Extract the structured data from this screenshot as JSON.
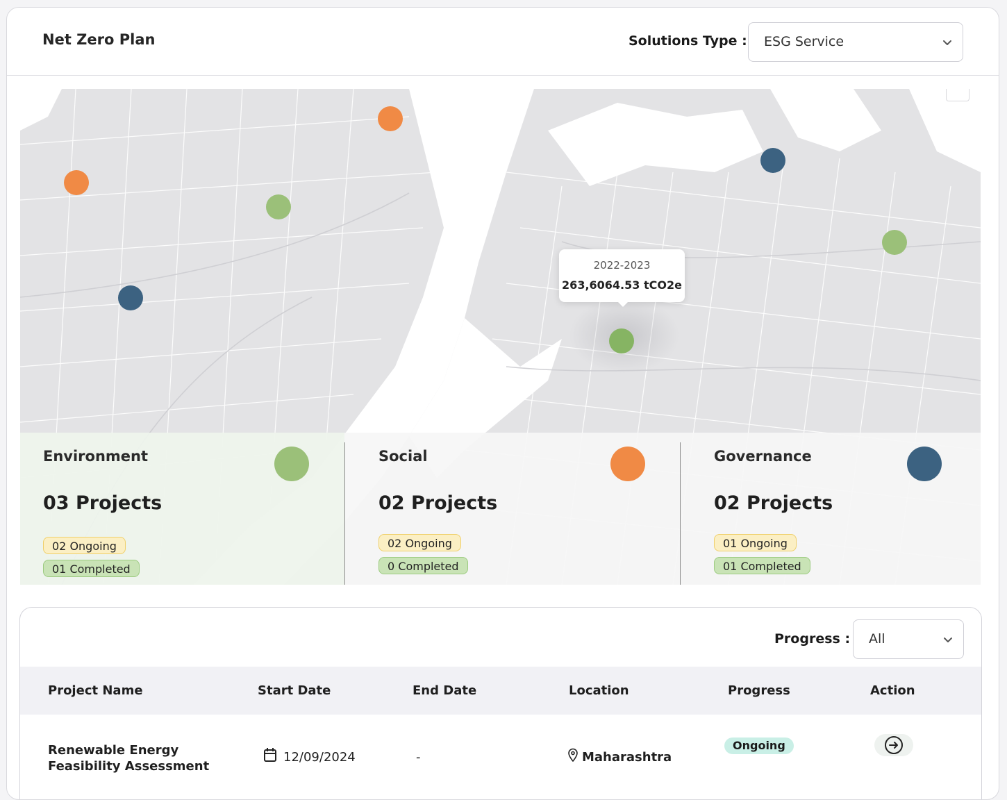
{
  "header": {
    "title": "Net Zero Plan",
    "solutions_label": "Solutions Type :",
    "solutions_value": "ESG Service"
  },
  "map": {
    "tooltip": {
      "period": "2022-2023",
      "value": "263,6064.53 tCO2e"
    },
    "markers": [
      {
        "category": "Environment",
        "color": "#9bc079"
      },
      {
        "category": "Social",
        "color": "#f08a45"
      },
      {
        "category": "Governance",
        "color": "#3c6281"
      }
    ]
  },
  "summary": [
    {
      "title": "Environment",
      "projects": "03 Projects",
      "ongoing": "02 Ongoing",
      "completed": "01 Completed",
      "color": "#9bc079"
    },
    {
      "title": "Social",
      "projects": "02 Projects",
      "ongoing": "02 Ongoing",
      "completed": "0 Completed",
      "color": "#f08a45"
    },
    {
      "title": "Governance",
      "projects": "02 Projects",
      "ongoing": "01 Ongoing",
      "completed": "01 Completed",
      "color": "#3c6281"
    }
  ],
  "table": {
    "progress_label": "Progress :",
    "progress_value": "All",
    "columns": [
      "Project Name",
      "Start Date",
      "End Date",
      "Location",
      "Progress",
      "Action"
    ],
    "rows": [
      {
        "name": "Renewable Energy Feasibility Assessment",
        "start": "12/09/2024",
        "end": "-",
        "location": "Maharashtra",
        "status": "Ongoing"
      }
    ]
  }
}
